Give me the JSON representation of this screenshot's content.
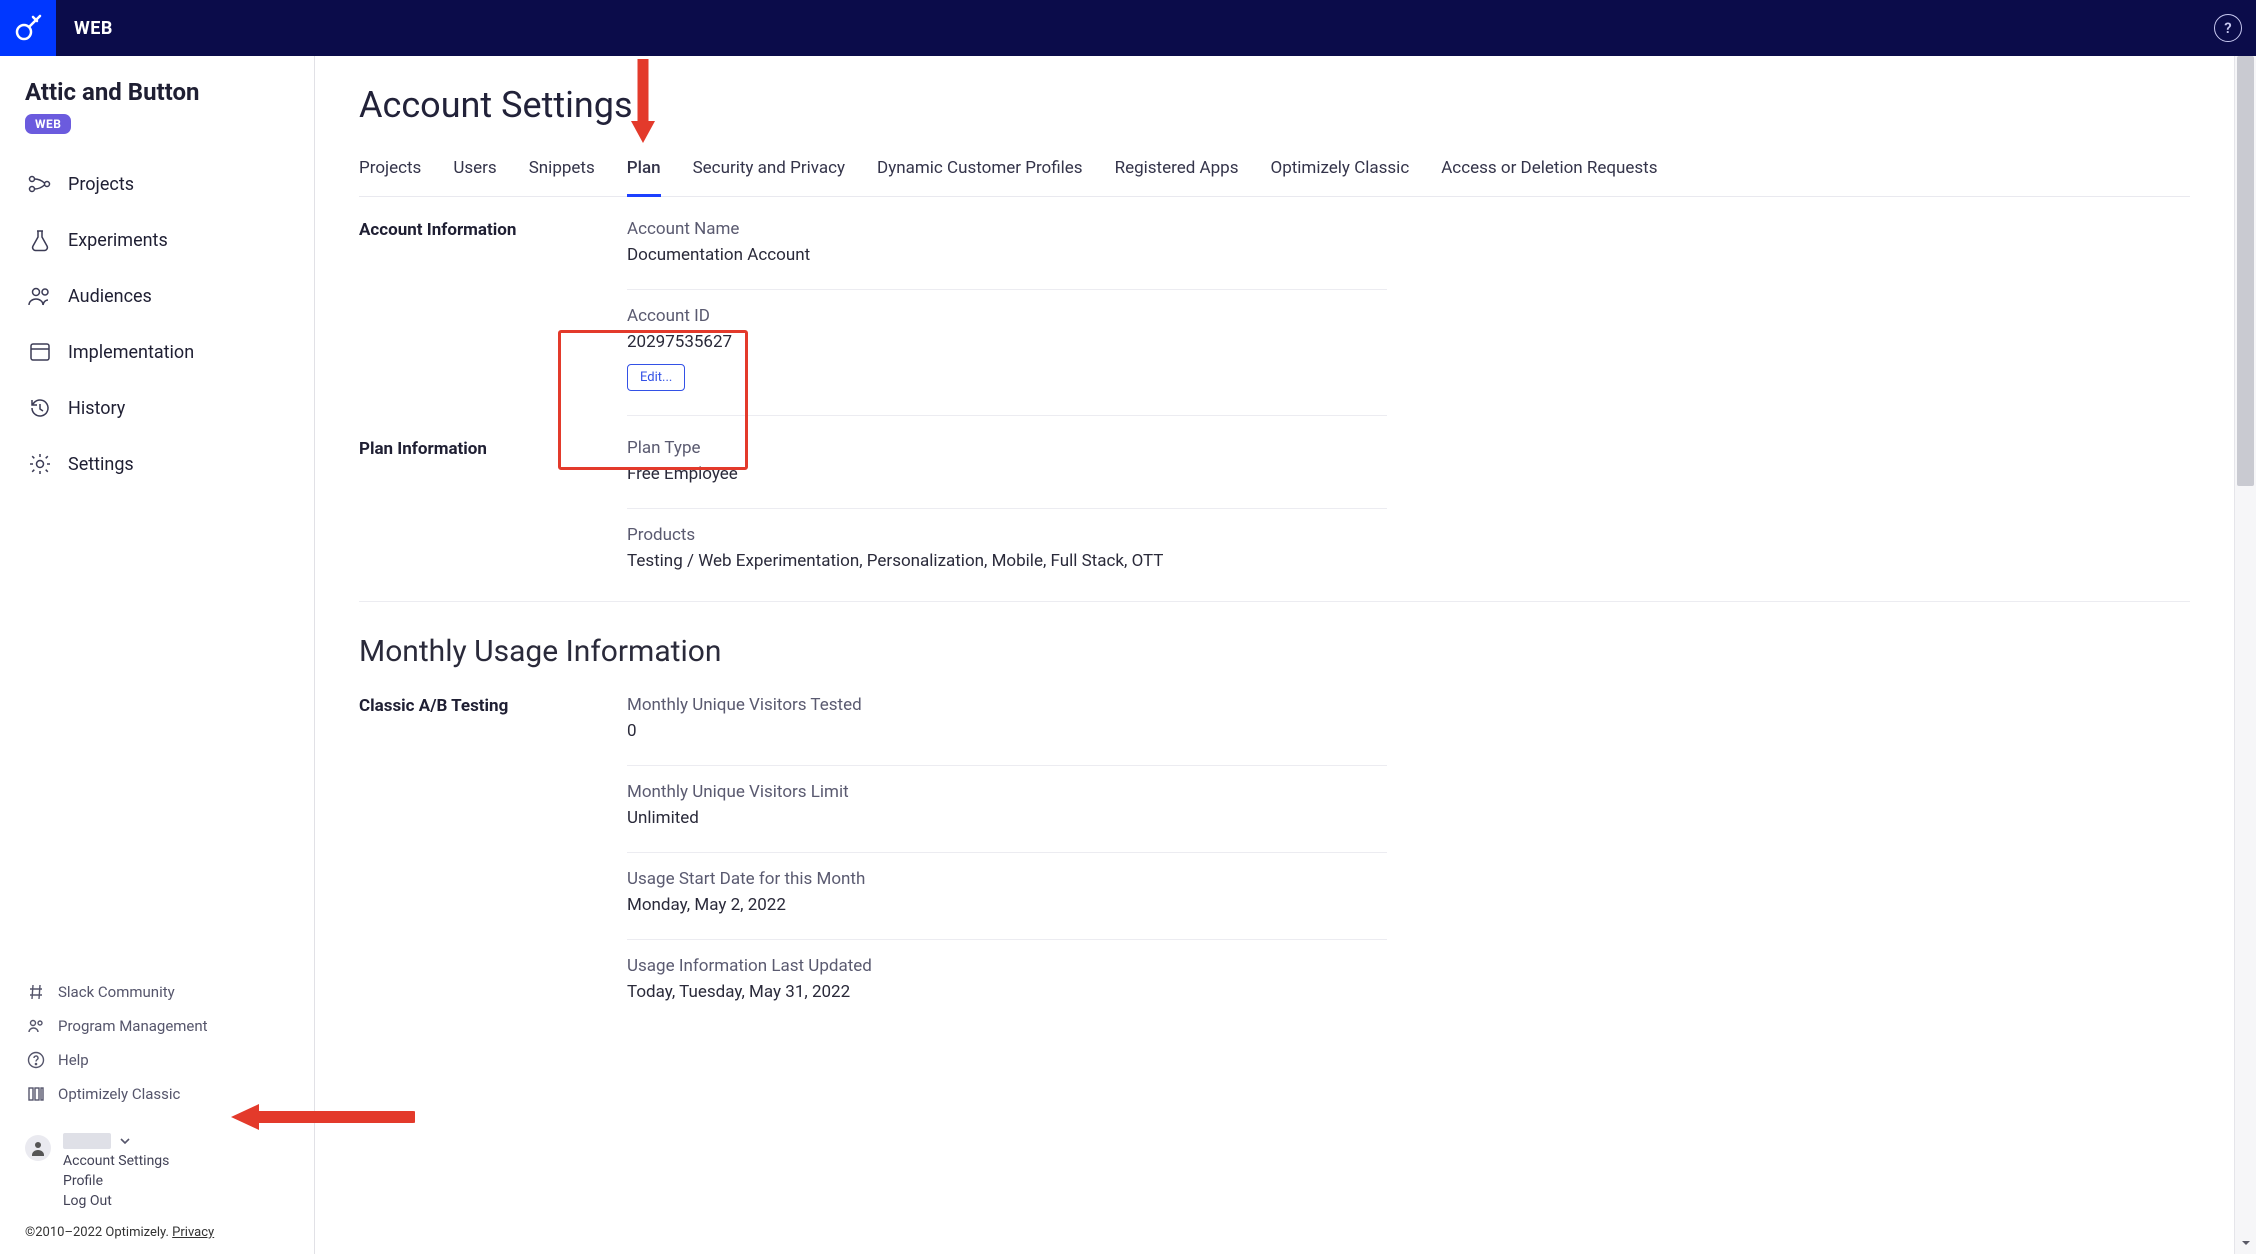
{
  "topbar": {
    "title": "WEB"
  },
  "sidebar": {
    "org_name": "Attic and Button",
    "chip_label": "WEB",
    "nav": [
      {
        "label": "Projects"
      },
      {
        "label": "Experiments"
      },
      {
        "label": "Audiences"
      },
      {
        "label": "Implementation"
      },
      {
        "label": "History"
      },
      {
        "label": "Settings"
      }
    ],
    "lower_links": [
      {
        "label": "Slack Community"
      },
      {
        "label": "Program Management"
      },
      {
        "label": "Help"
      },
      {
        "label": "Optimizely Classic"
      }
    ],
    "user_menu": {
      "account_settings": "Account Settings",
      "profile": "Profile",
      "log_out": "Log Out"
    }
  },
  "footer": {
    "copyright": "©2010–2022 Optimizely. ",
    "privacy": "Privacy"
  },
  "page": {
    "title": "Account Settings",
    "tabs": [
      {
        "label": "Projects"
      },
      {
        "label": "Users"
      },
      {
        "label": "Snippets"
      },
      {
        "label": "Plan",
        "active": true
      },
      {
        "label": "Security and Privacy"
      },
      {
        "label": "Dynamic Customer Profiles"
      },
      {
        "label": "Registered Apps"
      },
      {
        "label": "Optimizely Classic"
      },
      {
        "label": "Access or Deletion Requests"
      }
    ]
  },
  "account_info": {
    "section_label": "Account Information",
    "account_name_label": "Account Name",
    "account_name_value": "Documentation Account",
    "account_id_label": "Account ID",
    "account_id_value": "20297535627",
    "edit_label": "Edit..."
  },
  "plan_info": {
    "section_label": "Plan Information",
    "plan_type_label": "Plan Type",
    "plan_type_value": "Free Employee",
    "products_label": "Products",
    "products_value": "Testing / Web Experimentation, Personalization, Mobile, Full Stack, OTT"
  },
  "usage": {
    "heading": "Monthly Usage Information",
    "section_label": "Classic A/B Testing",
    "mu_tested_label": "Monthly Unique Visitors Tested",
    "mu_tested_value": "0",
    "mu_limit_label": "Monthly Unique Visitors Limit",
    "mu_limit_value": "Unlimited",
    "start_date_label": "Usage Start Date for this Month",
    "start_date_value": "Monday, May 2, 2022",
    "last_updated_label": "Usage Information Last Updated",
    "last_updated_value": "Today, Tuesday, May 31, 2022"
  }
}
